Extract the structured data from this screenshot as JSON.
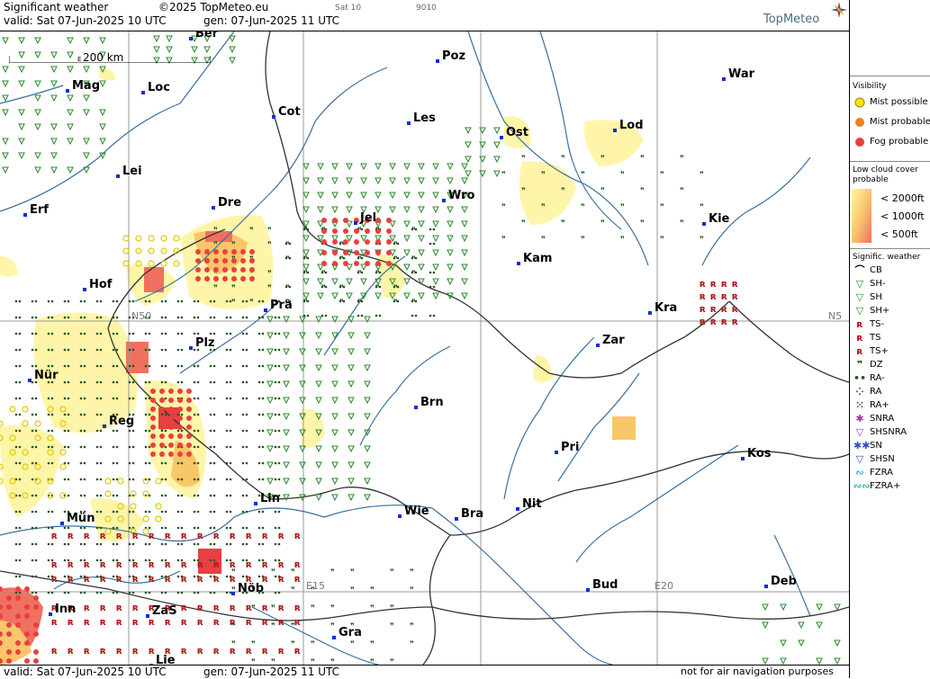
{
  "header": {
    "title": "Significant weather",
    "copyright": "©2025 TopMeteo.eu",
    "sat_label": "Sat 10",
    "code": "9010",
    "valid": "valid:  Sat  07-Jun-2025  10 UTC",
    "gen": "gen: 07-Jun-2025 11 UTC",
    "logo": "TopMeteo"
  },
  "footer": {
    "valid": "valid:  Sat  07-Jun-2025  10 UTC",
    "gen": "gen: 07-Jun-2025 11 UTC",
    "disclaimer": "not for air navigation purposes"
  },
  "scale": {
    "label": "200 km",
    "left_mark": "E"
  },
  "gridlabels": {
    "n50_left": "N50",
    "n50_right": "N5",
    "e15": "E15",
    "e20": "E20"
  },
  "cities": [
    {
      "name": "Ber"
    },
    {
      "name": "Poz"
    },
    {
      "name": "War"
    },
    {
      "name": "Mag"
    },
    {
      "name": "Loc"
    },
    {
      "name": "Cot"
    },
    {
      "name": "Les"
    },
    {
      "name": "Ost"
    },
    {
      "name": "Lod"
    },
    {
      "name": "Lei"
    },
    {
      "name": "Dre"
    },
    {
      "name": "Wro"
    },
    {
      "name": "Jel"
    },
    {
      "name": "Erf"
    },
    {
      "name": "Kie"
    },
    {
      "name": "Kam"
    },
    {
      "name": "Hof"
    },
    {
      "name": "Pra"
    },
    {
      "name": "Kra"
    },
    {
      "name": "Plz"
    },
    {
      "name": "Zar"
    },
    {
      "name": "Nür"
    },
    {
      "name": "Brn"
    },
    {
      "name": "Reg"
    },
    {
      "name": "Pri"
    },
    {
      "name": "Kos"
    },
    {
      "name": "Nit"
    },
    {
      "name": "Lin"
    },
    {
      "name": "Wie"
    },
    {
      "name": "Bra"
    },
    {
      "name": "Mün"
    },
    {
      "name": "Deb"
    },
    {
      "name": "Nöb"
    },
    {
      "name": "Bud"
    },
    {
      "name": "Inn"
    },
    {
      "name": "ZaS"
    },
    {
      "name": "Gra"
    },
    {
      "name": "Lie"
    }
  ],
  "legend": {
    "visibility_title": "Visibility",
    "visibility": [
      {
        "label": "Mist possible",
        "color": "#f7e600"
      },
      {
        "label": "Mist probable",
        "color": "#f08020"
      },
      {
        "label": "Fog probable",
        "color": "#e84040"
      }
    ],
    "lowcloud_title": "Low cloud cover probable",
    "lowcloud": [
      {
        "label": "< 2000ft",
        "color": "#fff5a8"
      },
      {
        "label": "< 1000ft",
        "color": "#f9c66a"
      },
      {
        "label": "<   500ft",
        "color": "#f07060"
      }
    ],
    "signif_title": "Signific. weather",
    "signif": [
      {
        "label": "CB",
        "sym": "⌒",
        "color": "#000"
      },
      {
        "label": "SH-",
        "sym": "▽",
        "color": "#2a8a2a"
      },
      {
        "label": "SH",
        "sym": "▽",
        "color": "#2a8a2a"
      },
      {
        "label": "SH+",
        "sym": "▽",
        "color": "#2a8a2a"
      },
      {
        "label": "TS-",
        "sym": "ʀ",
        "color": "#b01818"
      },
      {
        "label": "TS",
        "sym": "ʀ",
        "color": "#b01818"
      },
      {
        "label": "TS+",
        "sym": "ʀ",
        "color": "#b01818"
      },
      {
        "label": "DZ",
        "sym": "❞",
        "color": "#225522"
      },
      {
        "label": "RA-",
        "sym": "••",
        "color": "#225522"
      },
      {
        "label": "RA",
        "sym": "⁘",
        "color": "#225522"
      },
      {
        "label": "RA+",
        "sym": "⁙",
        "color": "#225522"
      },
      {
        "label": "SNRA",
        "sym": "✱",
        "color": "#b030b0"
      },
      {
        "label": "SHSNRA",
        "sym": "▽",
        "color": "#b030b0"
      },
      {
        "label": "SN",
        "sym": "✱✱",
        "color": "#3050c0"
      },
      {
        "label": "SHSN",
        "sym": "▽",
        "color": "#3050c0"
      },
      {
        "label": "FZRA",
        "sym": "∾",
        "color": "#20b0c0"
      },
      {
        "label": "FZRA+",
        "sym": "∾∾",
        "color": "#20b0c0"
      }
    ]
  }
}
